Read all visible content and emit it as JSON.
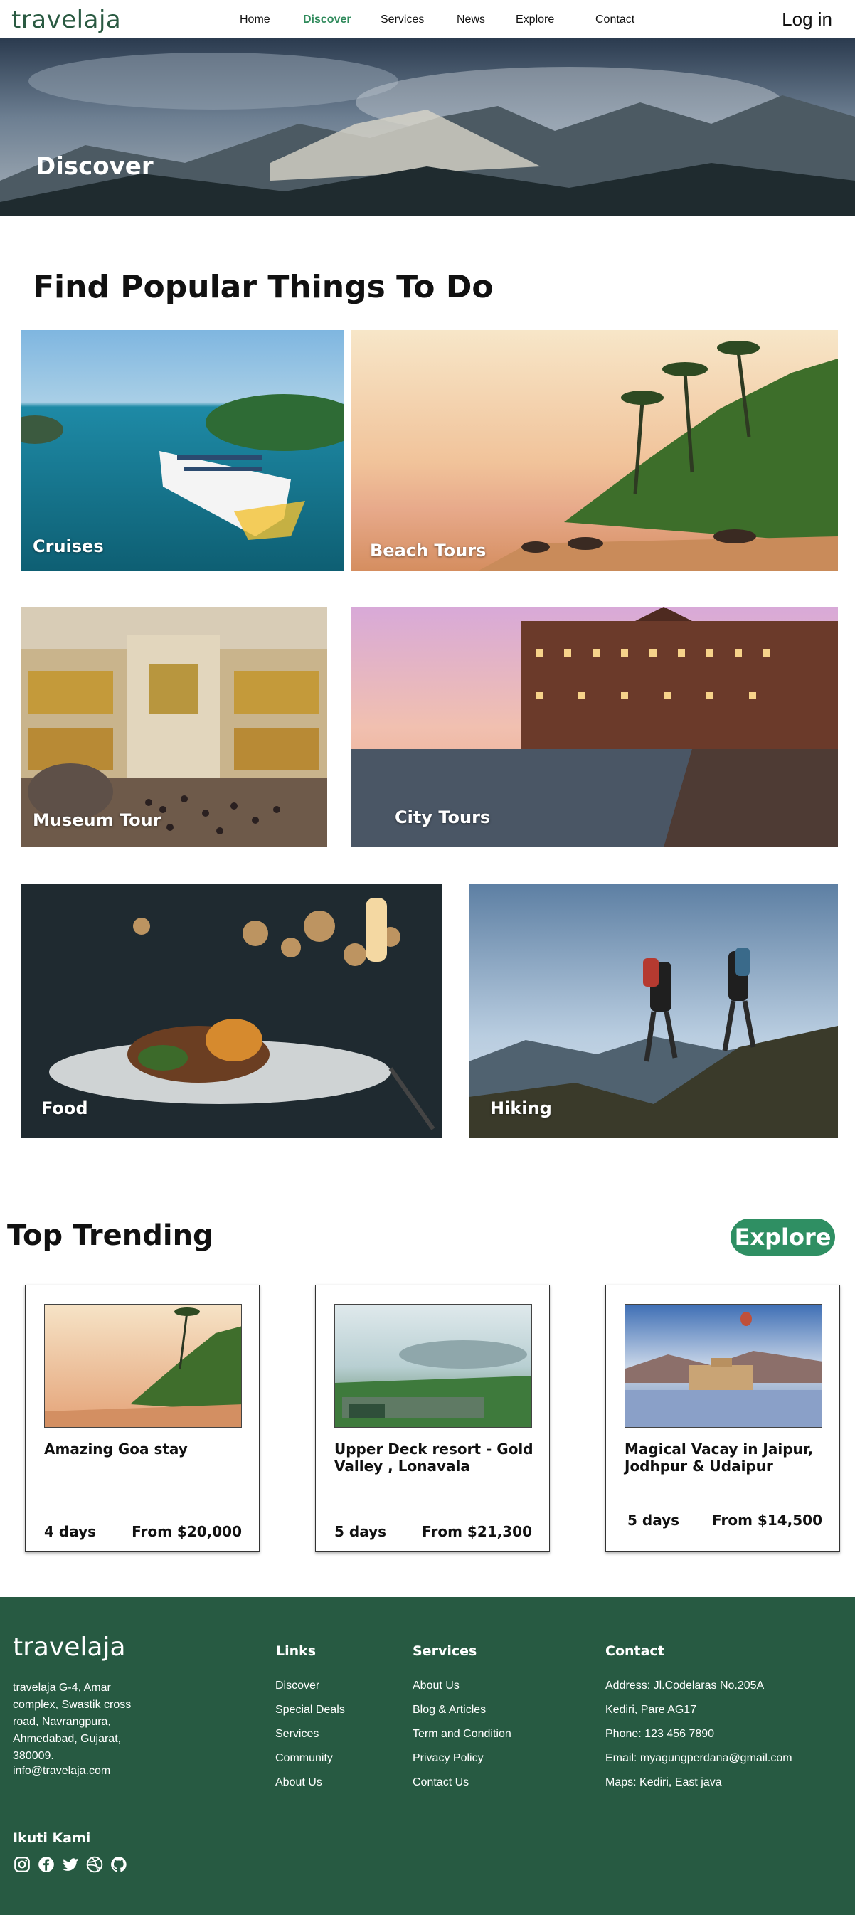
{
  "nav": {
    "logo": "travelaja",
    "links": [
      "Home",
      "Discover",
      "Services",
      "News",
      "Explore",
      "Contact"
    ],
    "active": "Discover",
    "login": "Log in"
  },
  "hero": {
    "title": "Discover"
  },
  "popular": {
    "title": "Find Popular Things To Do",
    "tiles": [
      "Cruises",
      "Beach Tours",
      "Museum Tour",
      "City Tours",
      "Food",
      "Hiking"
    ]
  },
  "trending": {
    "title": "Top Trending",
    "explore_label": "Explore",
    "cards": [
      {
        "title": "Amazing Goa stay",
        "days": "4 days",
        "price": "From $20,000"
      },
      {
        "title": "Upper Deck resort - Gold Valley , Lonavala",
        "days": "5 days",
        "price": "From $21,300"
      },
      {
        "title": "Magical Vacay in Jaipur, Jodhpur & Udaipur",
        "days": "5 days",
        "price": "From $14,500"
      }
    ]
  },
  "footer": {
    "logo": "travelaja",
    "address": "travelaja G-4, Amar complex, Swastik cross road, Navrangpura, Ahmedabad, Gujarat, 380009.",
    "email": "info@travelaja.com",
    "links_title": "Links",
    "links": [
      "Discover",
      "Special Deals",
      "Services",
      "Community",
      "About Us"
    ],
    "services_title": "Services",
    "services": [
      "About Us",
      "Blog & Articles",
      "Term and Condition",
      "Privacy Policy",
      "Contact Us"
    ],
    "contact_title": "Contact",
    "contact": [
      "Address: Jl.Codelaras No.205A",
      "Kediri, Pare AG17",
      "Phone: 123 456 7890",
      "Email: myagungperdana@gmail.com",
      "Maps: Kediri, East java"
    ],
    "social_title": "Ikuti Kami",
    "social_icons": [
      "instagram-icon",
      "facebook-icon",
      "twitter-icon",
      "dribbble-icon",
      "github-icon"
    ]
  },
  "colors": {
    "brand_green": "#275a42",
    "accent_green": "#2f8f63",
    "active_link": "#2f8a5b"
  }
}
